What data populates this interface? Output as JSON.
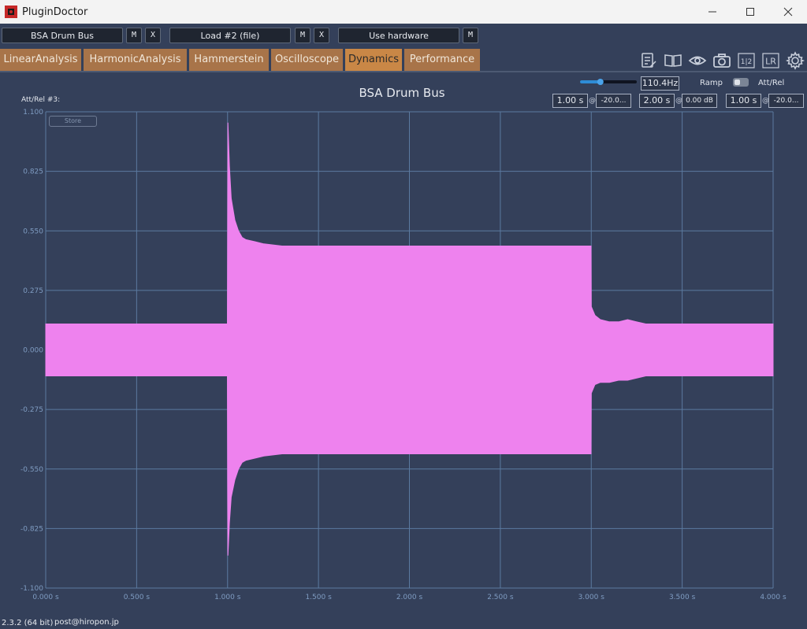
{
  "window": {
    "title": "PluginDoctor"
  },
  "plugins": {
    "slot1": {
      "name": "BSA Drum Bus",
      "m": "M",
      "x": "X"
    },
    "slot2": {
      "name": "Load #2 (file)",
      "m": "M",
      "x": "X"
    },
    "slot3": {
      "name": "Use hardware",
      "m": "M"
    }
  },
  "tabs": [
    {
      "label": "LinearAnalysis",
      "active": false
    },
    {
      "label": "HarmonicAnalysis",
      "active": false
    },
    {
      "label": "Hammerstein",
      "active": false
    },
    {
      "label": "Oscilloscope",
      "active": false
    },
    {
      "label": "Dynamics",
      "active": true
    },
    {
      "label": "Performance",
      "active": false
    }
  ],
  "toolbar": {
    "icons": [
      "notes-icon",
      "book-icon",
      "eye-icon",
      "camera-icon",
      "split-view-icon",
      "lr-icon",
      "gear-icon"
    ],
    "split_label": "1|2",
    "lr_label": "LR"
  },
  "controls": {
    "frequency": "110.4Hz",
    "slider_fraction": 0.35,
    "ramp_label": "Ramp",
    "attrel_label": "Att/Rel",
    "at_symbol": "@",
    "seg1": {
      "time": "1.00 s",
      "level": "-20.0..."
    },
    "seg2": {
      "time": "2.00 s",
      "level": "0.00 dB"
    },
    "seg3": {
      "time": "1.00 s",
      "level": "-20.0..."
    }
  },
  "chart_header": {
    "title": "BSA Drum Bus",
    "attrel_overlay": "Att/Rel #3:",
    "store_label": "Store"
  },
  "chart_data": {
    "type": "area",
    "title": "BSA Drum Bus",
    "xlabel": "",
    "ylabel": "",
    "xlim": [
      0,
      4
    ],
    "ylim": [
      -1.1,
      1.1
    ],
    "grid": true,
    "color": "#ee82ee",
    "x_ticks": [
      "0.000 s",
      "0.500 s",
      "1.000 s",
      "1.500 s",
      "2.000 s",
      "2.500 s",
      "3.000 s",
      "3.500 s",
      "4.000 s"
    ],
    "y_ticks": [
      "1.100",
      "0.825",
      "0.550",
      "0.275",
      "0.000",
      "-0.275",
      "-0.550",
      "-0.825",
      "-1.100"
    ],
    "envelope": {
      "t": [
        0.0,
        0.999,
        1.0,
        1.002,
        1.01,
        1.02,
        1.04,
        1.06,
        1.08,
        1.1,
        1.15,
        1.2,
        1.3,
        1.5,
        2.0,
        2.5,
        2.999,
        3.0,
        3.02,
        3.05,
        3.1,
        3.15,
        3.2,
        3.25,
        3.3,
        3.4,
        3.6,
        4.0
      ],
      "upper": [
        0.12,
        0.12,
        0.55,
        1.05,
        0.85,
        0.7,
        0.6,
        0.55,
        0.52,
        0.51,
        0.5,
        0.49,
        0.48,
        0.48,
        0.48,
        0.48,
        0.48,
        0.2,
        0.16,
        0.14,
        0.13,
        0.13,
        0.14,
        0.13,
        0.12,
        0.12,
        0.12,
        0.12
      ],
      "lower": [
        -0.12,
        -0.12,
        -0.6,
        -0.95,
        -0.8,
        -0.68,
        -0.6,
        -0.55,
        -0.52,
        -0.51,
        -0.5,
        -0.49,
        -0.48,
        -0.48,
        -0.48,
        -0.48,
        -0.48,
        -0.2,
        -0.16,
        -0.15,
        -0.15,
        -0.14,
        -0.14,
        -0.13,
        -0.12,
        -0.12,
        -0.12,
        -0.12
      ]
    }
  },
  "status": {
    "version": "2.3.2 (64 bit)",
    "email": "post@hiropon.jp"
  },
  "colors": {
    "accent_tab": "#c98746",
    "tab": "#a87449",
    "background": "#34405a",
    "waveform": "#ee82ee"
  }
}
